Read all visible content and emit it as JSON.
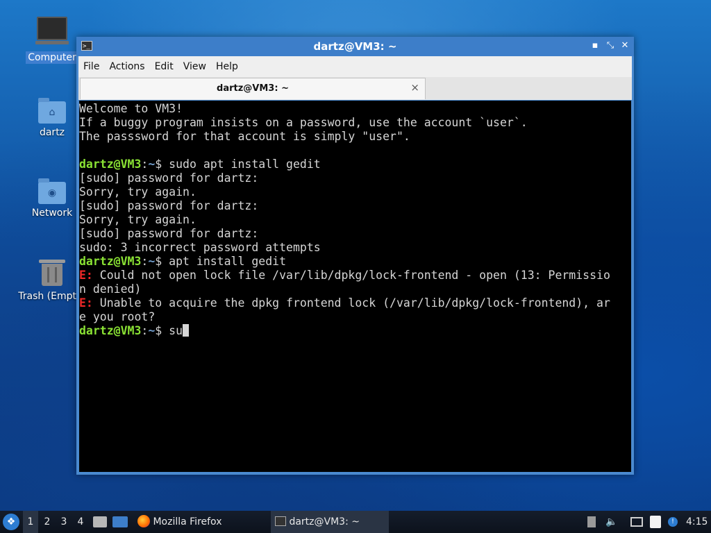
{
  "desktop": {
    "icons": [
      {
        "label": "Computer",
        "glyph": "computer-icon",
        "selected": true
      },
      {
        "label": "dartz",
        "glyph": "home-folder-icon"
      },
      {
        "label": "Network",
        "glyph": "network-folder-icon"
      },
      {
        "label": "Trash (Empty)",
        "glyph": "trash-icon"
      }
    ]
  },
  "window": {
    "title": "dartz@VM3: ~",
    "menu": [
      "File",
      "Actions",
      "Edit",
      "View",
      "Help"
    ],
    "tab_title": "dartz@VM3: ~",
    "tab_close": "×",
    "controls": {
      "minimize": "▪",
      "maximize": "⤡",
      "close": "✕"
    }
  },
  "terminal": {
    "lines": [
      {
        "type": "text",
        "text": "Welcome to VM3!"
      },
      {
        "type": "text",
        "text": "If a buggy program insists on a password, use the account `user`."
      },
      {
        "type": "text",
        "text": "The passsword for that account is simply \"user\"."
      },
      {
        "type": "text",
        "text": ""
      },
      {
        "type": "prompt",
        "user": "dartz@VM3",
        "path": "~",
        "cmd": "sudo apt install gedit"
      },
      {
        "type": "text",
        "text": "[sudo] password for dartz:"
      },
      {
        "type": "text",
        "text": "Sorry, try again."
      },
      {
        "type": "text",
        "text": "[sudo] password for dartz:"
      },
      {
        "type": "text",
        "text": "Sorry, try again."
      },
      {
        "type": "text",
        "text": "[sudo] password for dartz:"
      },
      {
        "type": "text",
        "text": "sudo: 3 incorrect password attempts"
      },
      {
        "type": "prompt",
        "user": "dartz@VM3",
        "path": "~",
        "cmd": "apt install gedit"
      },
      {
        "type": "error",
        "tag": "E:",
        "text": " Could not open lock file /var/lib/dpkg/lock-frontend - open (13: Permissio"
      },
      {
        "type": "text",
        "text": "n denied)"
      },
      {
        "type": "error",
        "tag": "E:",
        "text": " Unable to acquire the dpkg frontend lock (/var/lib/dpkg/lock-frontend), ar"
      },
      {
        "type": "text",
        "text": "e you root?"
      },
      {
        "type": "prompt",
        "user": "dartz@VM3",
        "path": "~",
        "cmd": "su",
        "cursor": true
      }
    ]
  },
  "taskbar": {
    "workspaces": [
      "1",
      "2",
      "3",
      "4"
    ],
    "active_workspace": "1",
    "tasks": [
      {
        "label": "Mozilla Firefox",
        "icon": "firefox-icon"
      },
      {
        "label": "dartz@VM3: ~",
        "icon": "terminal-icon",
        "active": true
      }
    ],
    "clock": "4:15"
  }
}
